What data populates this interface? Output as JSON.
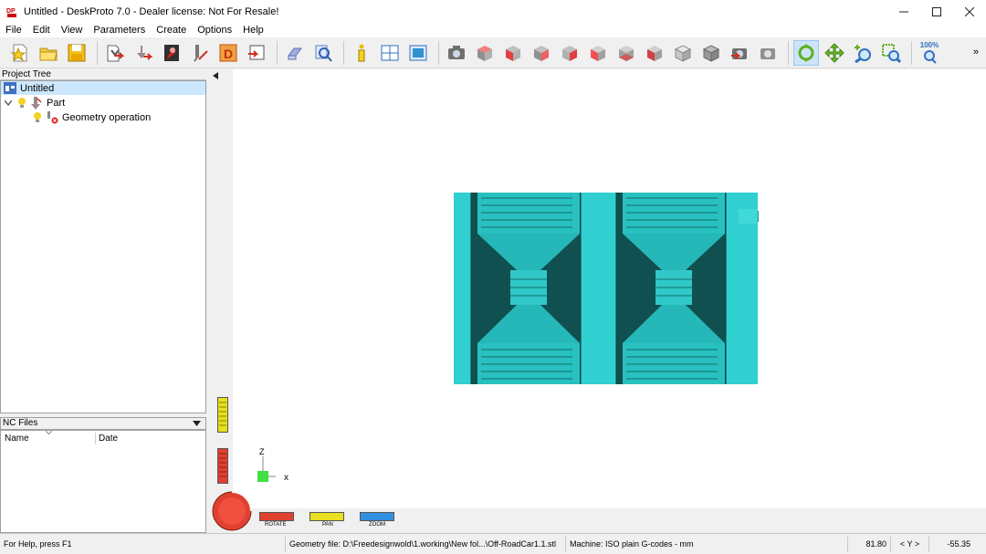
{
  "window": {
    "title": "Untitled - DeskProto 7.0 - Dealer license: Not For Resale!"
  },
  "menu": [
    "File",
    "Edit",
    "View",
    "Parameters",
    "Create",
    "Options",
    "Help"
  ],
  "toolbar": {
    "zoom_label": "100%",
    "more": "»"
  },
  "project_tree": {
    "header": "Project Tree",
    "root": "Untitled",
    "part": "Part",
    "operation": "Geometry operation"
  },
  "nc_files": {
    "header": "NC Files",
    "columns": [
      "Name",
      "Date"
    ]
  },
  "viewport": {
    "axis_z": "Z",
    "axis_x": "x",
    "rotate": "ROTATE",
    "pan": "PAN",
    "zoom": "ZOOM",
    "model_color": "#2ec4c4"
  },
  "status": {
    "help": "For Help, press F1",
    "geometry_file": "Geometry file: D:\\Freedesignwold\\1.working\\New fol...\\Off-RoadCar1.1.stl",
    "machine": "Machine: ISO plain G-codes - mm",
    "x_value": "81.80",
    "axis": "< Y >",
    "y_value": "-55.35"
  }
}
